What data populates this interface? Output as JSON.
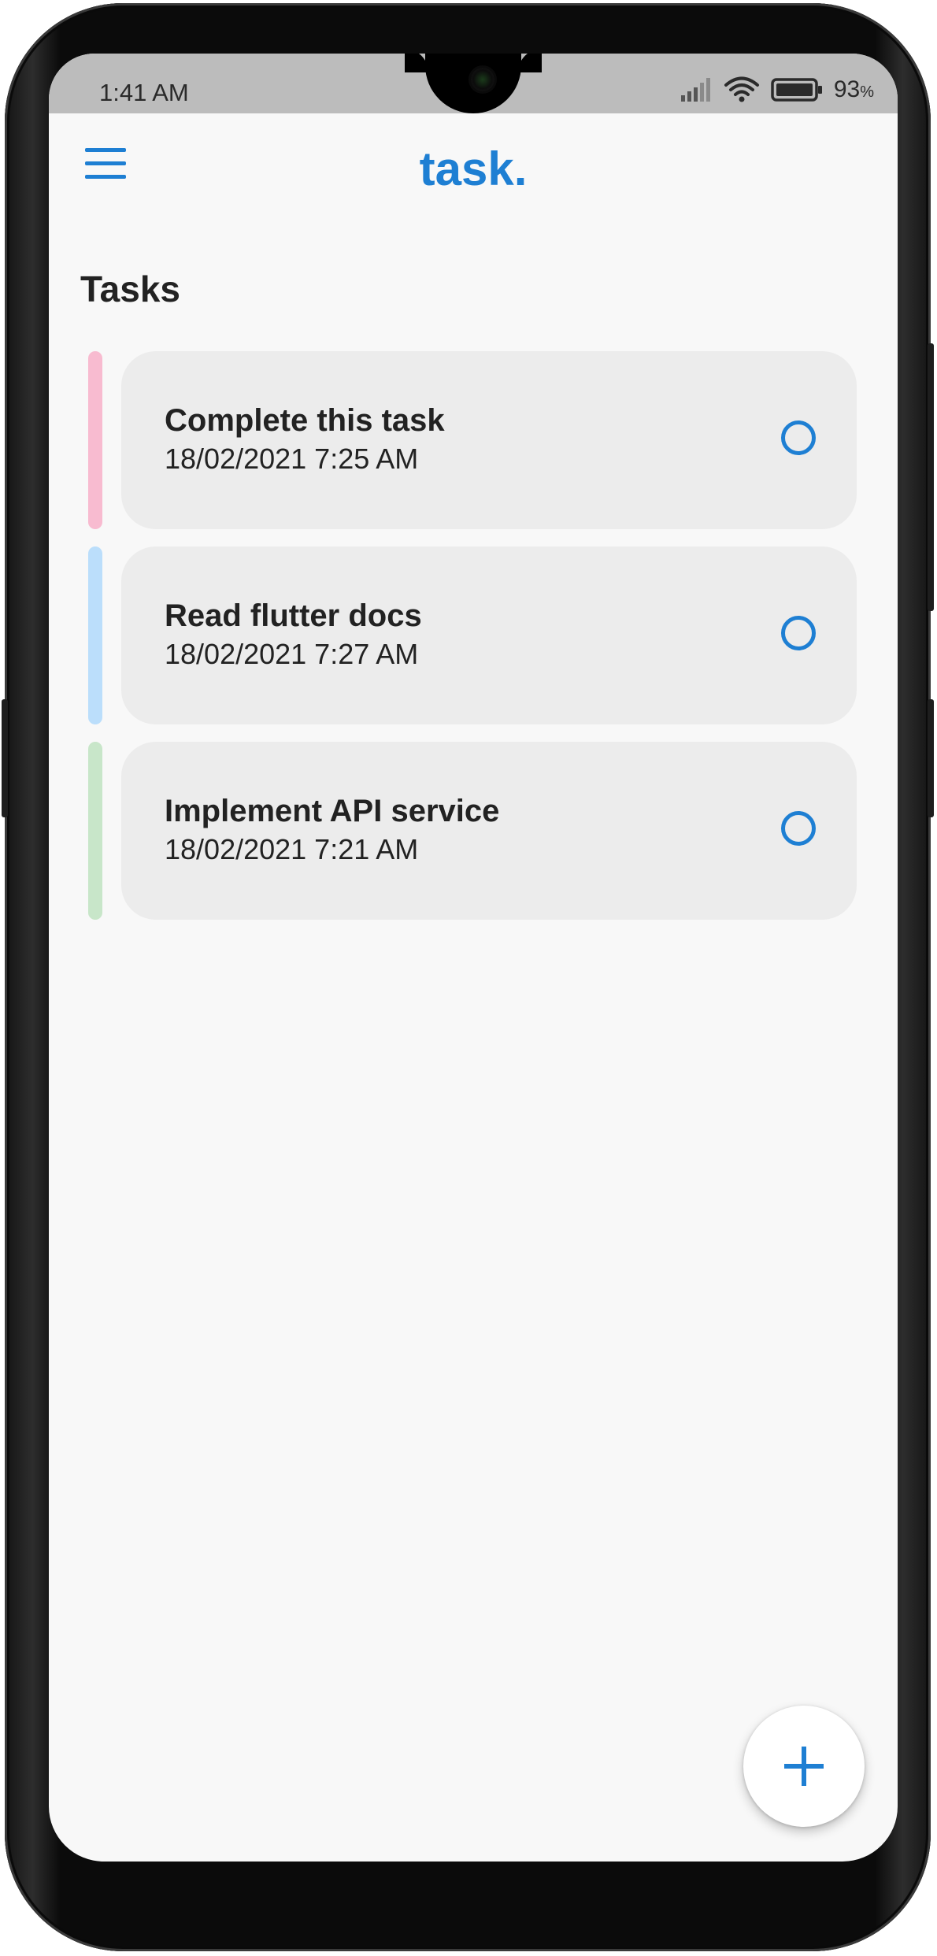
{
  "status_bar": {
    "time": "1:41 AM",
    "battery_percent": "93",
    "battery_unit": "%",
    "signal_icon": "signal-icon",
    "wifi_icon": "wifi-icon",
    "battery_icon": "battery-icon"
  },
  "app_bar": {
    "logo": "task.",
    "menu_icon": "hamburger-menu-icon"
  },
  "section": {
    "title": "Tasks"
  },
  "tasks": [
    {
      "title": "Complete this task",
      "datetime": "18/02/2021 7:25 AM",
      "color": "#f8bbd0",
      "completed": false
    },
    {
      "title": "Read flutter docs",
      "datetime": "18/02/2021 7:27 AM",
      "color": "#bbdefb",
      "completed": false
    },
    {
      "title": "Implement API service",
      "datetime": "18/02/2021 7:21 AM",
      "color": "#c8e6c9",
      "completed": false
    }
  ],
  "fab": {
    "icon": "plus-icon"
  },
  "colors": {
    "accent": "#1e7fd3",
    "card_background": "#ececec",
    "screen_background": "#f8f8f8"
  }
}
